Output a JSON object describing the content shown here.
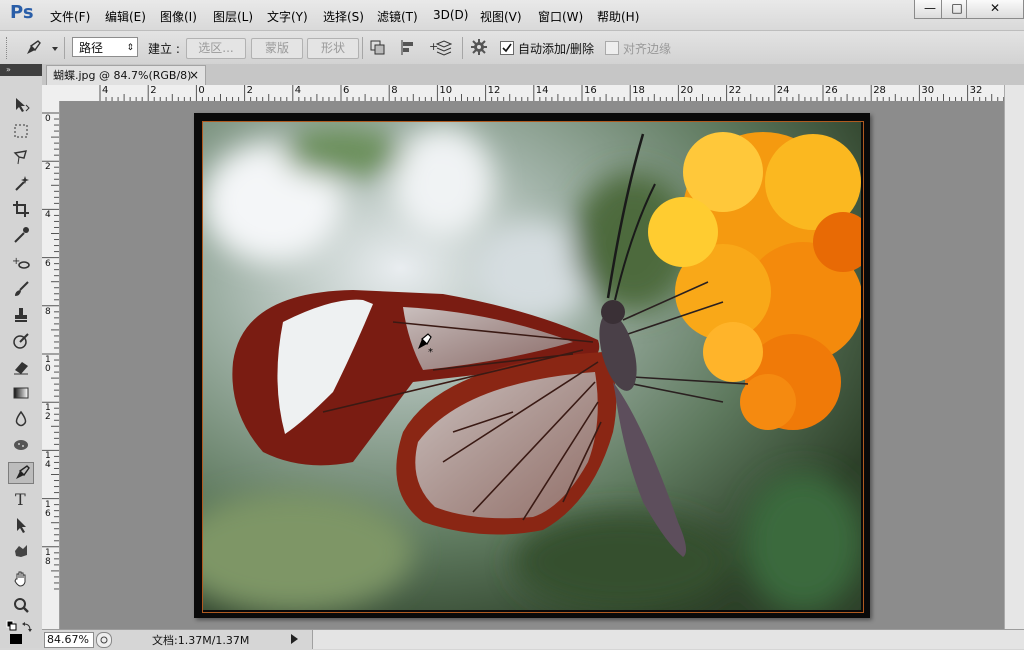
{
  "app": {
    "logo": "Ps"
  },
  "menu": [
    "文件(F)",
    "编辑(E)",
    "图像(I)",
    "图层(L)",
    "文字(Y)",
    "选择(S)",
    "滤镜(T)",
    "3D(D)",
    "视图(V)",
    "窗口(W)",
    "帮助(H)"
  ],
  "window_controls": {
    "minimize": "—",
    "maximize": "□",
    "close": "✕"
  },
  "options": {
    "mode": "路径",
    "make_label": "建立 :",
    "selection_btn": "选区...",
    "mask_btn": "蒙版",
    "shape_btn": "形状",
    "auto_add_delete": "自动添加/删除",
    "auto_add_delete_checked": true,
    "align_edges": "对齐边缘",
    "align_edges_checked": false
  },
  "document_tab": {
    "title": "蝴蝶.jpg @ 84.7%(RGB/8)",
    "close": "×"
  },
  "toolbox": {
    "collapse": "»"
  },
  "rulers": {
    "horizontal": [
      "4",
      "2",
      "0",
      "2",
      "4",
      "6",
      "8",
      "10",
      "12",
      "14",
      "16",
      "18",
      "20",
      "22",
      "24",
      "26",
      "28",
      "30",
      "32"
    ],
    "vertical": [
      "0",
      "2",
      "4",
      "6",
      "8",
      "10",
      "12",
      "14",
      "16",
      "18"
    ]
  },
  "status": {
    "zoom": "84.67%",
    "doc_info": "文档:1.37M/1.37M"
  },
  "colors": {
    "accent": "#2a5ea8",
    "canvas_bg": "#8c8c8c",
    "wing_edge": "#8a1f10",
    "flower": "#f59a10"
  }
}
